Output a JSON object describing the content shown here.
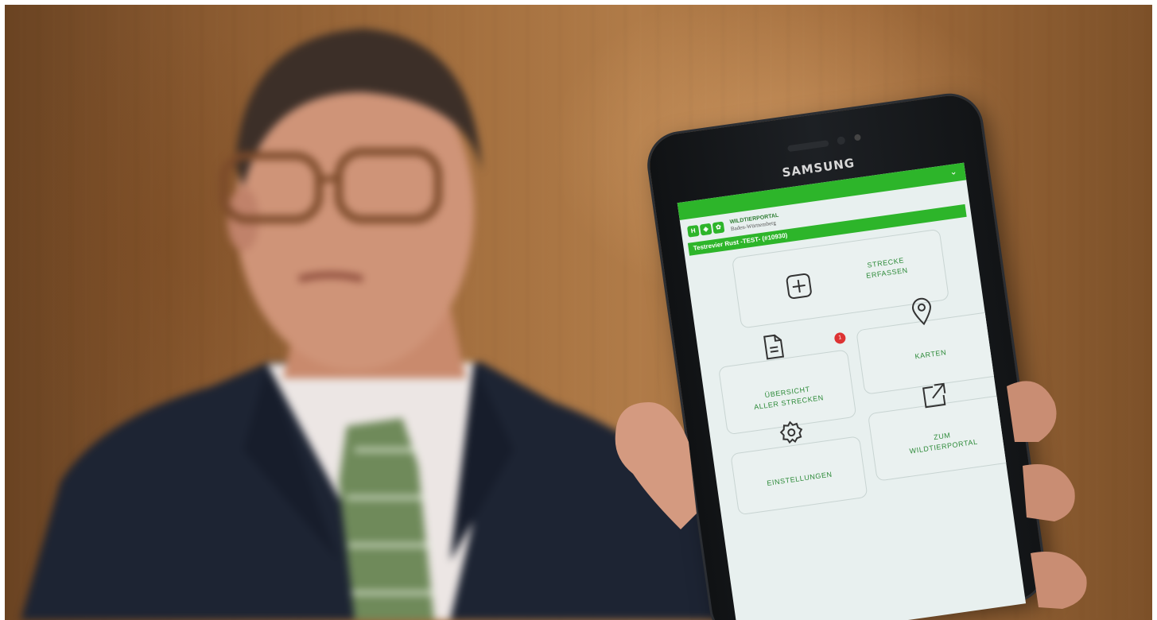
{
  "device": {
    "brand": "SAMSUNG"
  },
  "app": {
    "logo_title": "WILDTIERPORTAL",
    "logo_subtitle": "Baden-Württemberg",
    "revier": "Testrevier Rust -TEST- (#10930)",
    "tiles": [
      {
        "id": "strecke",
        "label_line1": "STRECKE",
        "label_line2": "ERFASSEN",
        "icon": "plus-square-icon"
      },
      {
        "id": "uebersicht",
        "label_line1": "ÜBERSICHT",
        "label_line2": "ALLER STRECKEN",
        "icon": "document-icon",
        "badge": "1"
      },
      {
        "id": "karten",
        "label_line1": "KARTEN",
        "label_line2": "",
        "icon": "map-pin-icon"
      },
      {
        "id": "einstellungen",
        "label_line1": "EINSTELLUNGEN",
        "label_line2": "",
        "icon": "gear-icon"
      },
      {
        "id": "wildtierportal",
        "label_line1": "ZUM",
        "label_line2": "WILDTIERPORTAL",
        "icon": "external-link-icon"
      }
    ]
  },
  "colors": {
    "accent_green": "#2db52a",
    "label_green": "#2e8b3a",
    "screen_bg": "#e8f0ef"
  }
}
